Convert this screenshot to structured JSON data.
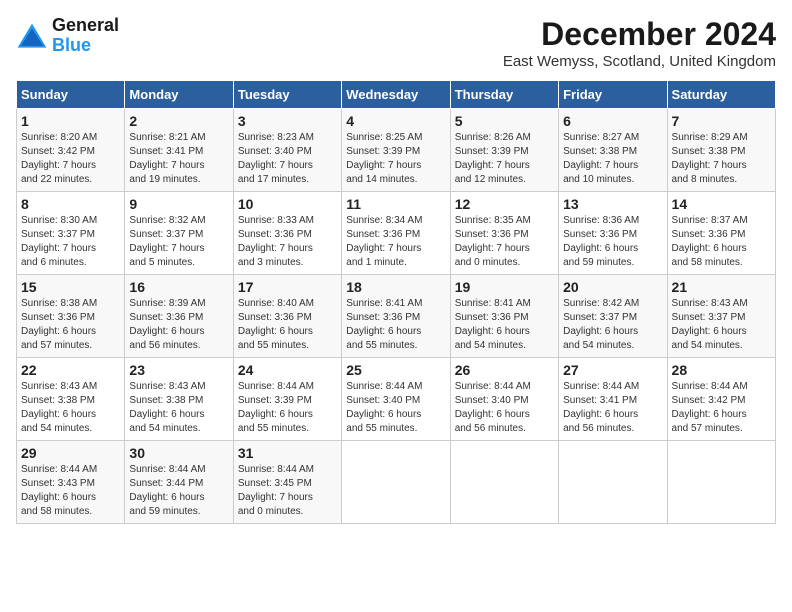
{
  "logo": {
    "line1": "General",
    "line2": "Blue"
  },
  "title": "December 2024",
  "subtitle": "East Wemyss, Scotland, United Kingdom",
  "days_of_week": [
    "Sunday",
    "Monday",
    "Tuesday",
    "Wednesday",
    "Thursday",
    "Friday",
    "Saturday"
  ],
  "weeks": [
    [
      {
        "day": "1",
        "detail": "Sunrise: 8:20 AM\nSunset: 3:42 PM\nDaylight: 7 hours\nand 22 minutes."
      },
      {
        "day": "2",
        "detail": "Sunrise: 8:21 AM\nSunset: 3:41 PM\nDaylight: 7 hours\nand 19 minutes."
      },
      {
        "day": "3",
        "detail": "Sunrise: 8:23 AM\nSunset: 3:40 PM\nDaylight: 7 hours\nand 17 minutes."
      },
      {
        "day": "4",
        "detail": "Sunrise: 8:25 AM\nSunset: 3:39 PM\nDaylight: 7 hours\nand 14 minutes."
      },
      {
        "day": "5",
        "detail": "Sunrise: 8:26 AM\nSunset: 3:39 PM\nDaylight: 7 hours\nand 12 minutes."
      },
      {
        "day": "6",
        "detail": "Sunrise: 8:27 AM\nSunset: 3:38 PM\nDaylight: 7 hours\nand 10 minutes."
      },
      {
        "day": "7",
        "detail": "Sunrise: 8:29 AM\nSunset: 3:38 PM\nDaylight: 7 hours\nand 8 minutes."
      }
    ],
    [
      {
        "day": "8",
        "detail": "Sunrise: 8:30 AM\nSunset: 3:37 PM\nDaylight: 7 hours\nand 6 minutes."
      },
      {
        "day": "9",
        "detail": "Sunrise: 8:32 AM\nSunset: 3:37 PM\nDaylight: 7 hours\nand 5 minutes."
      },
      {
        "day": "10",
        "detail": "Sunrise: 8:33 AM\nSunset: 3:36 PM\nDaylight: 7 hours\nand 3 minutes."
      },
      {
        "day": "11",
        "detail": "Sunrise: 8:34 AM\nSunset: 3:36 PM\nDaylight: 7 hours\nand 1 minute."
      },
      {
        "day": "12",
        "detail": "Sunrise: 8:35 AM\nSunset: 3:36 PM\nDaylight: 7 hours\nand 0 minutes."
      },
      {
        "day": "13",
        "detail": "Sunrise: 8:36 AM\nSunset: 3:36 PM\nDaylight: 6 hours\nand 59 minutes."
      },
      {
        "day": "14",
        "detail": "Sunrise: 8:37 AM\nSunset: 3:36 PM\nDaylight: 6 hours\nand 58 minutes."
      }
    ],
    [
      {
        "day": "15",
        "detail": "Sunrise: 8:38 AM\nSunset: 3:36 PM\nDaylight: 6 hours\nand 57 minutes."
      },
      {
        "day": "16",
        "detail": "Sunrise: 8:39 AM\nSunset: 3:36 PM\nDaylight: 6 hours\nand 56 minutes."
      },
      {
        "day": "17",
        "detail": "Sunrise: 8:40 AM\nSunset: 3:36 PM\nDaylight: 6 hours\nand 55 minutes."
      },
      {
        "day": "18",
        "detail": "Sunrise: 8:41 AM\nSunset: 3:36 PM\nDaylight: 6 hours\nand 55 minutes."
      },
      {
        "day": "19",
        "detail": "Sunrise: 8:41 AM\nSunset: 3:36 PM\nDaylight: 6 hours\nand 54 minutes."
      },
      {
        "day": "20",
        "detail": "Sunrise: 8:42 AM\nSunset: 3:37 PM\nDaylight: 6 hours\nand 54 minutes."
      },
      {
        "day": "21",
        "detail": "Sunrise: 8:43 AM\nSunset: 3:37 PM\nDaylight: 6 hours\nand 54 minutes."
      }
    ],
    [
      {
        "day": "22",
        "detail": "Sunrise: 8:43 AM\nSunset: 3:38 PM\nDaylight: 6 hours\nand 54 minutes."
      },
      {
        "day": "23",
        "detail": "Sunrise: 8:43 AM\nSunset: 3:38 PM\nDaylight: 6 hours\nand 54 minutes."
      },
      {
        "day": "24",
        "detail": "Sunrise: 8:44 AM\nSunset: 3:39 PM\nDaylight: 6 hours\nand 55 minutes."
      },
      {
        "day": "25",
        "detail": "Sunrise: 8:44 AM\nSunset: 3:40 PM\nDaylight: 6 hours\nand 55 minutes."
      },
      {
        "day": "26",
        "detail": "Sunrise: 8:44 AM\nSunset: 3:40 PM\nDaylight: 6 hours\nand 56 minutes."
      },
      {
        "day": "27",
        "detail": "Sunrise: 8:44 AM\nSunset: 3:41 PM\nDaylight: 6 hours\nand 56 minutes."
      },
      {
        "day": "28",
        "detail": "Sunrise: 8:44 AM\nSunset: 3:42 PM\nDaylight: 6 hours\nand 57 minutes."
      }
    ],
    [
      {
        "day": "29",
        "detail": "Sunrise: 8:44 AM\nSunset: 3:43 PM\nDaylight: 6 hours\nand 58 minutes."
      },
      {
        "day": "30",
        "detail": "Sunrise: 8:44 AM\nSunset: 3:44 PM\nDaylight: 6 hours\nand 59 minutes."
      },
      {
        "day": "31",
        "detail": "Sunrise: 8:44 AM\nSunset: 3:45 PM\nDaylight: 7 hours\nand 0 minutes."
      },
      {
        "day": "",
        "detail": ""
      },
      {
        "day": "",
        "detail": ""
      },
      {
        "day": "",
        "detail": ""
      },
      {
        "day": "",
        "detail": ""
      }
    ]
  ]
}
